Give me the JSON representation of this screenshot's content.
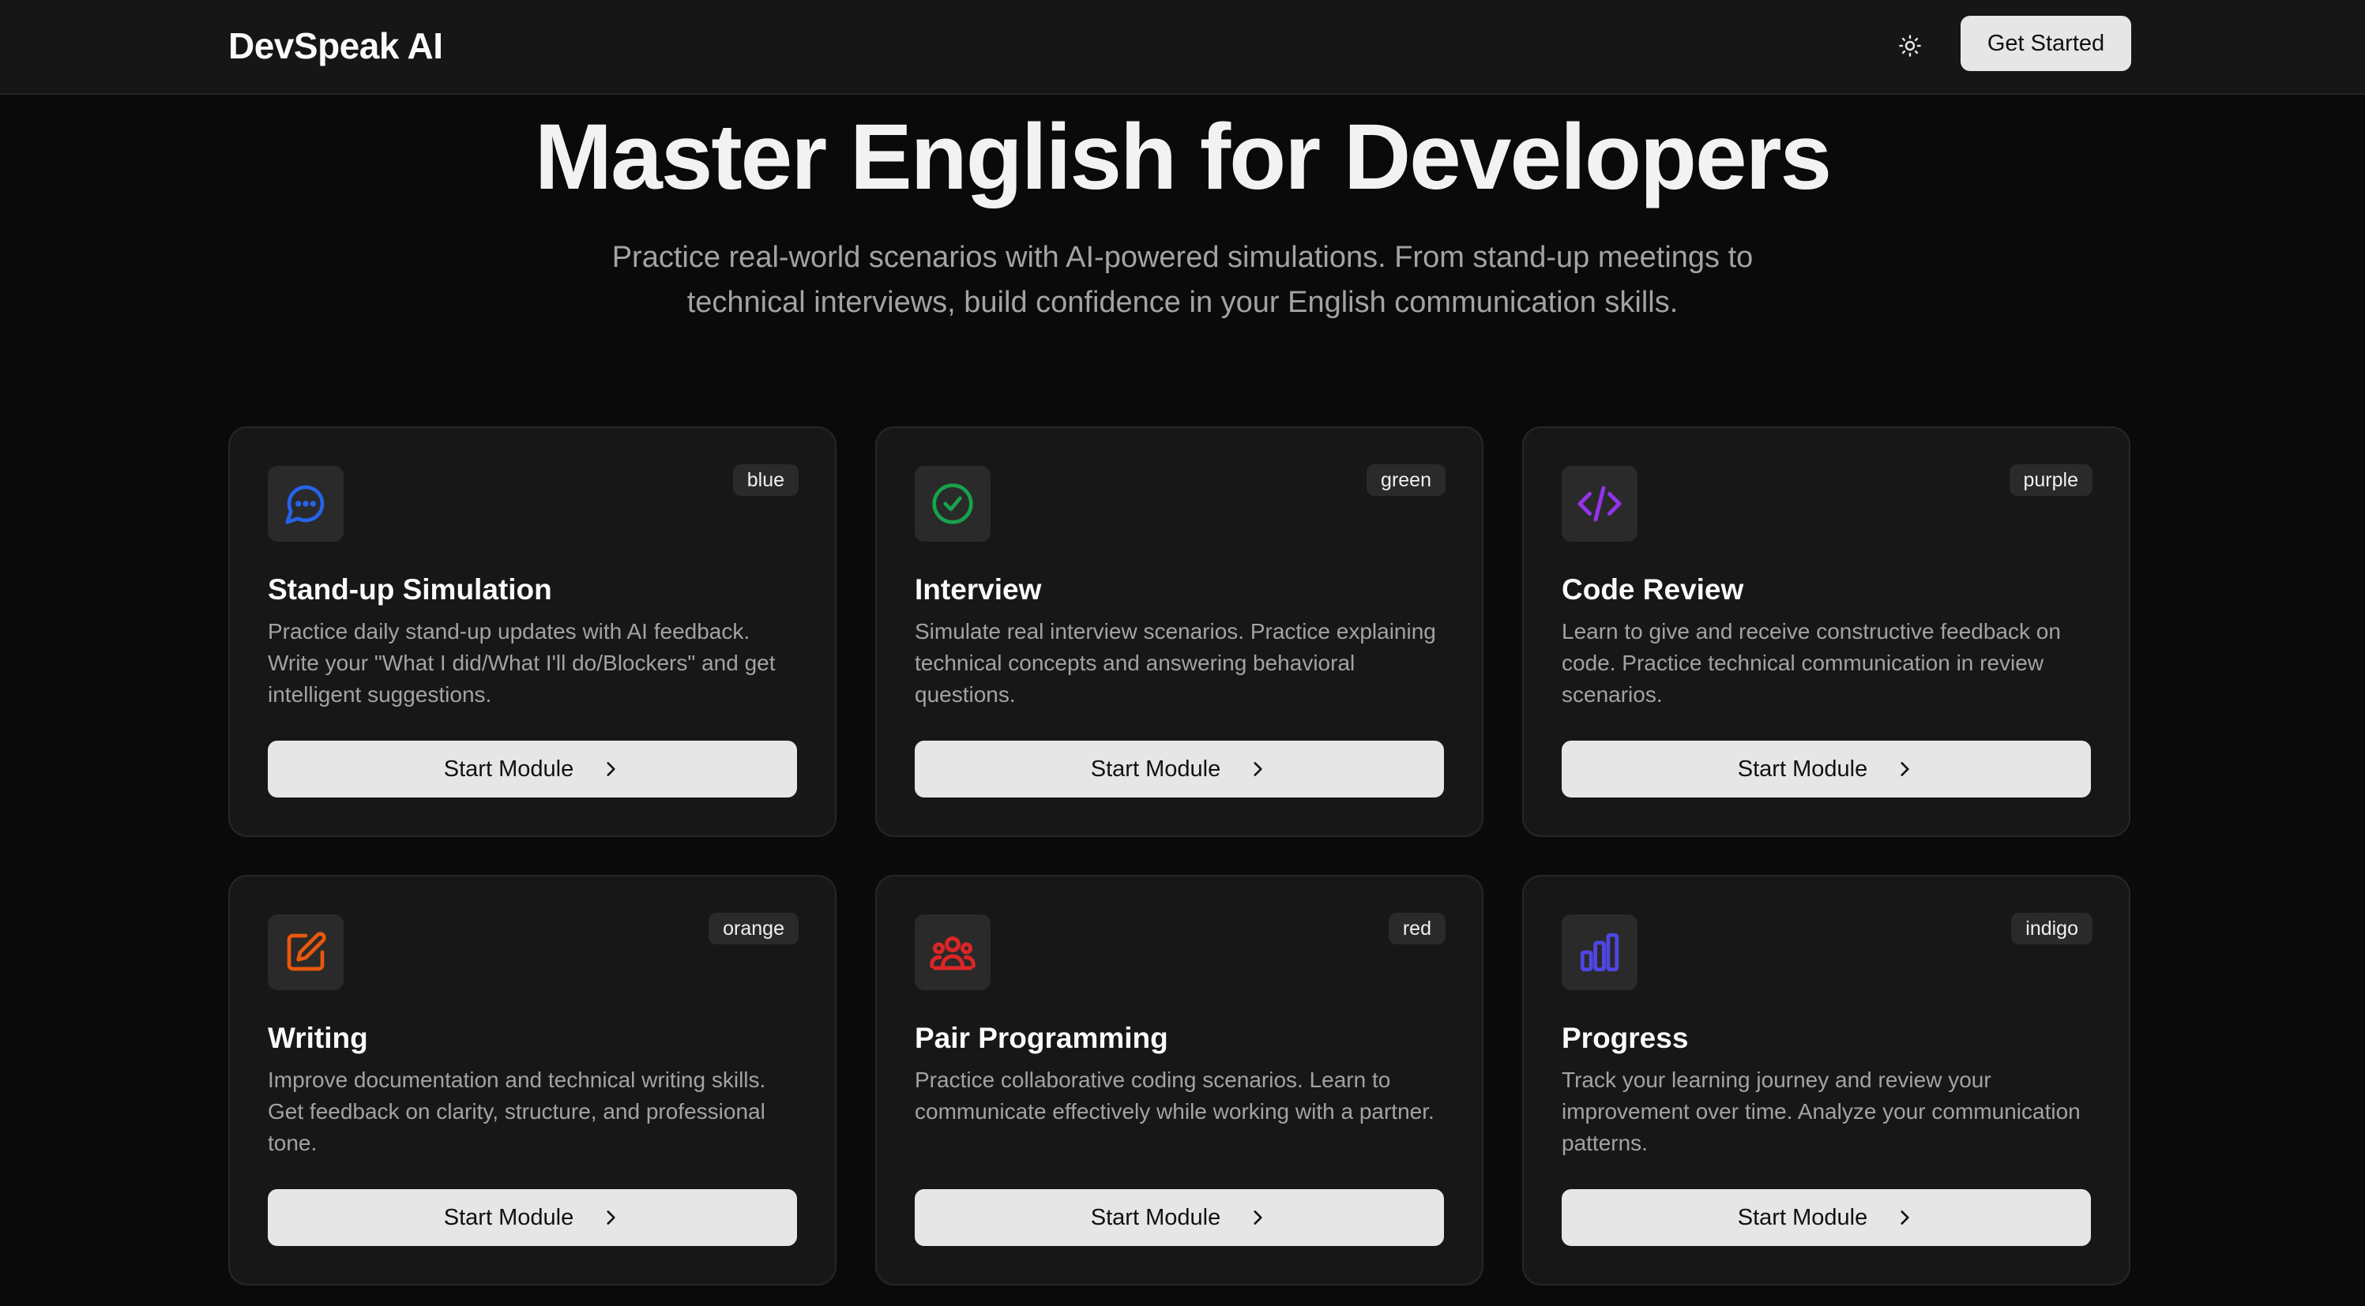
{
  "header": {
    "brand": "DevSpeak AI",
    "theme_icon": "sun-icon",
    "cta_label": "Get Started"
  },
  "hero": {
    "title": "Master English for Developers",
    "subtitle": "Practice real-world scenarios with AI-powered simulations. From stand-up meetings to technical interviews, build confidence in your English communication skills."
  },
  "modules": [
    {
      "title": "Stand-up Simulation",
      "description": "Practice daily stand-up updates with AI feedback. Write your \"What I did/What I'll do/Blockers\" and get intelligent suggestions.",
      "badge": "blue",
      "icon": "chat-bubble-icon",
      "color": "#2563eb",
      "button_label": "Start Module"
    },
    {
      "title": "Interview",
      "description": "Simulate real interview scenarios. Practice explaining technical concepts and answering behavioral questions.",
      "badge": "green",
      "icon": "check-circle-icon",
      "color": "#16a34a",
      "button_label": "Start Module"
    },
    {
      "title": "Code Review",
      "description": "Learn to give and receive constructive feedback on code. Practice technical communication in review scenarios.",
      "badge": "purple",
      "icon": "code-icon",
      "color": "#9333ea",
      "button_label": "Start Module"
    },
    {
      "title": "Writing",
      "description": "Improve documentation and technical writing skills. Get feedback on clarity, structure, and professional tone.",
      "badge": "orange",
      "icon": "edit-icon",
      "color": "#ea580c",
      "button_label": "Start Module"
    },
    {
      "title": "Pair Programming",
      "description": "Practice collaborative coding scenarios. Learn to communicate effectively while working with a partner.",
      "badge": "red",
      "icon": "users-icon",
      "color": "#dc2626",
      "button_label": "Start Module"
    },
    {
      "title": "Progress",
      "description": "Track your learning journey and review your improvement over time. Analyze your communication patterns.",
      "badge": "indigo",
      "icon": "bar-chart-icon",
      "color": "#4f46e5",
      "button_label": "Start Module"
    }
  ]
}
